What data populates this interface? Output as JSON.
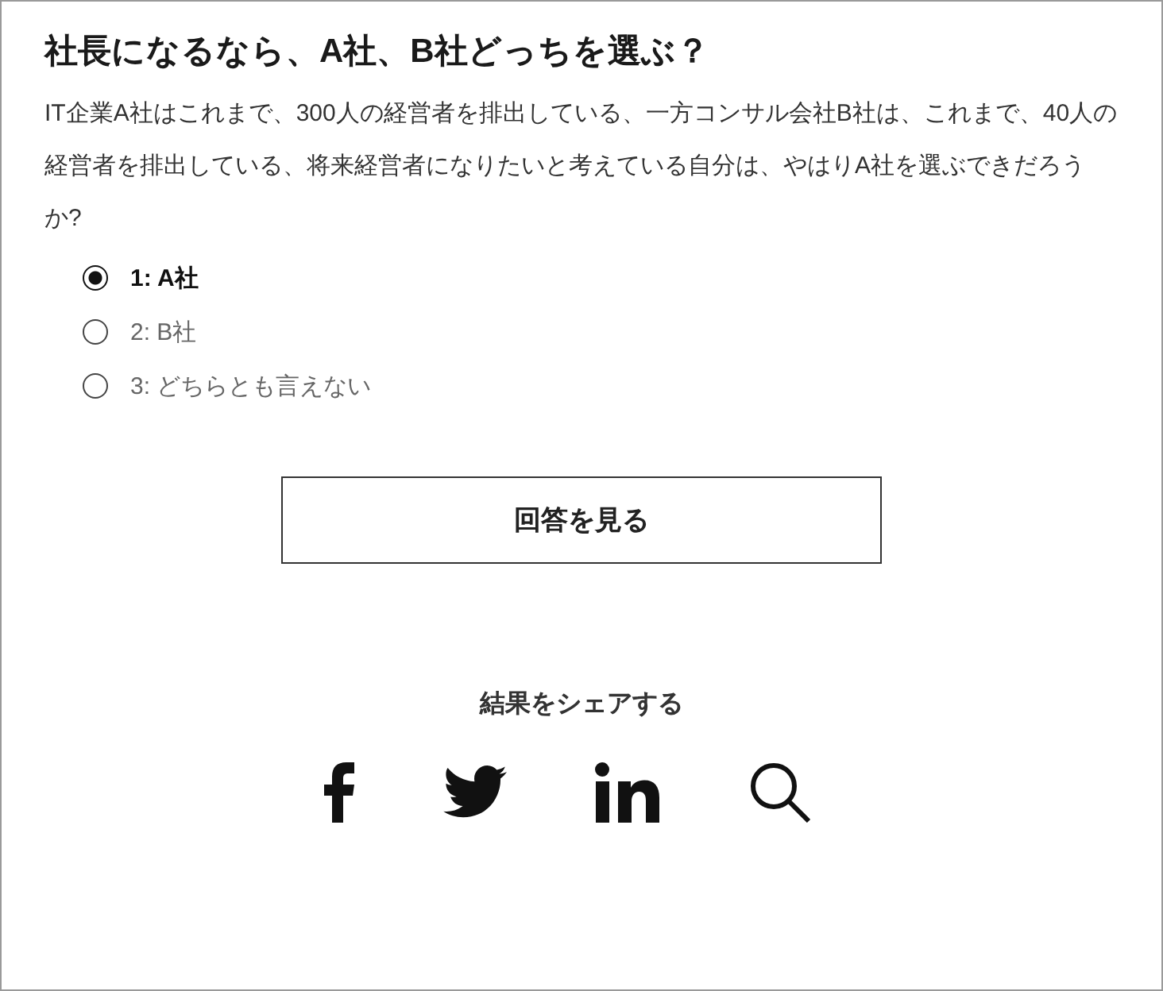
{
  "title": "社長になるなら、A社、B社どっちを選ぶ？",
  "question": "IT企業A社はこれまで、300人の経営者を排出している、一方コンサル会社B社は、これまで、40人の経営者を排出している、将来経営者になりたいと考えている自分は、やはりA社を選ぶできだろうか?",
  "options": [
    {
      "label": "1: A社",
      "selected": true
    },
    {
      "label": "2: B社",
      "selected": false
    },
    {
      "label": "3: どちらとも言えない",
      "selected": false
    }
  ],
  "answer_button": "回答を見る",
  "share": {
    "label": "結果をシェアする",
    "icons": [
      {
        "kind": "facebook"
      },
      {
        "kind": "twitter"
      },
      {
        "kind": "linkedin"
      },
      {
        "kind": "search"
      }
    ]
  }
}
